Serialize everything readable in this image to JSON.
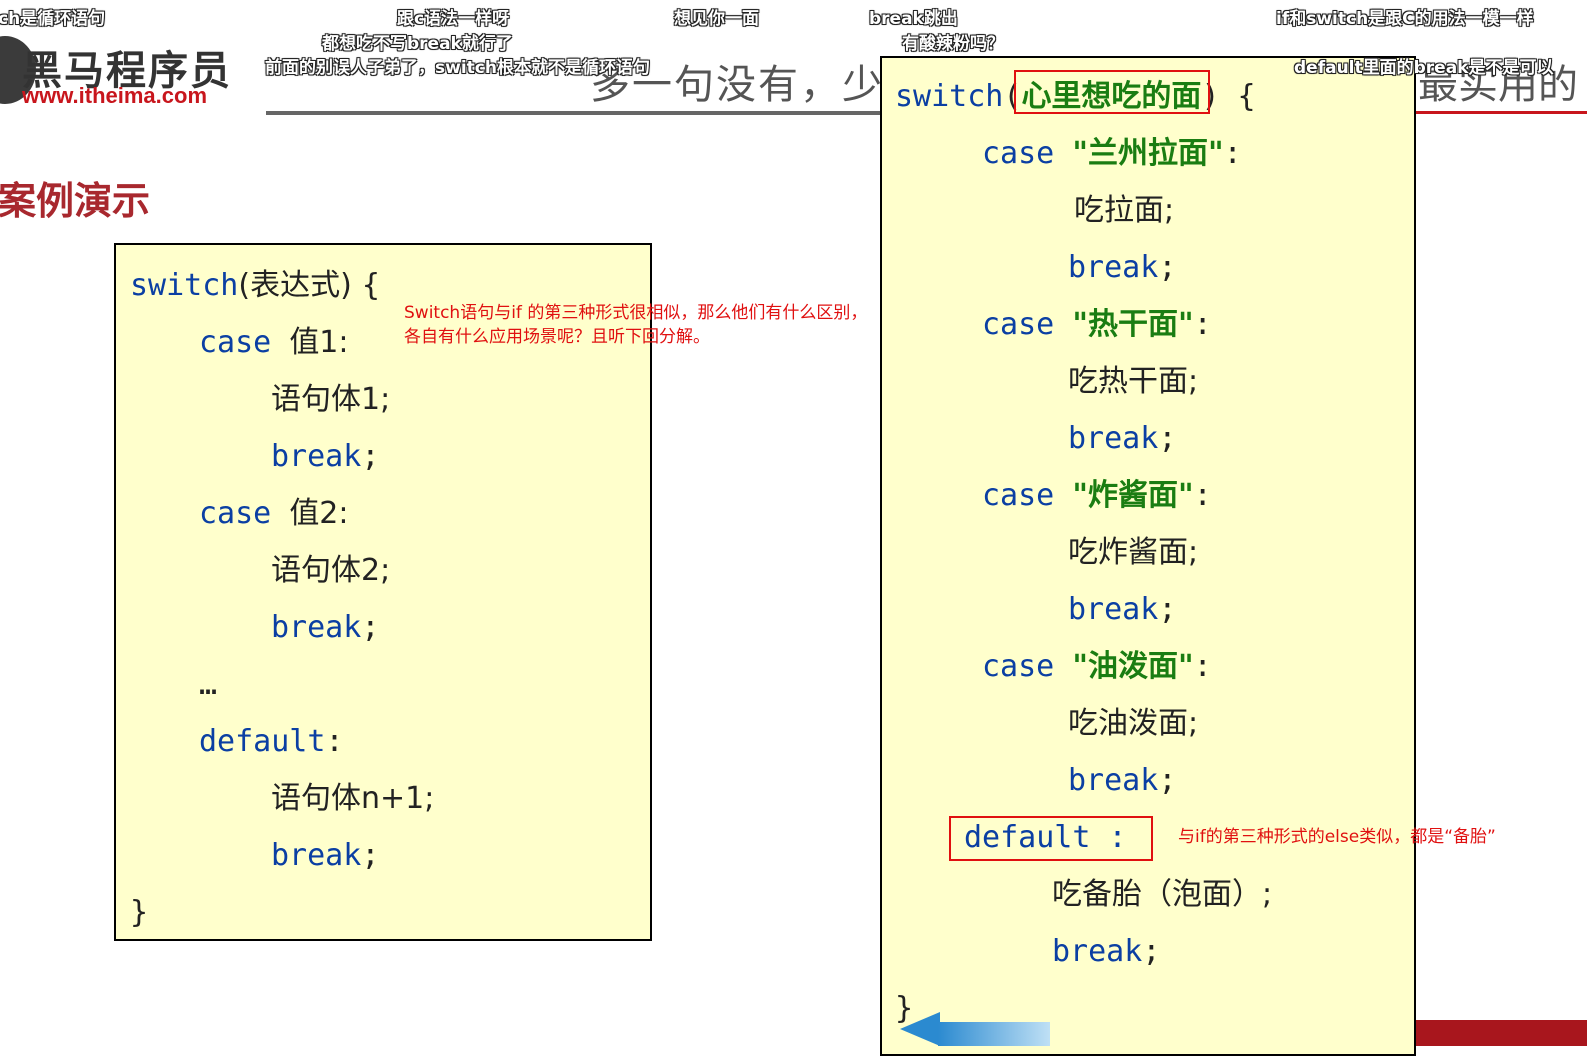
{
  "header": {
    "logo_name": "黑马程序员",
    "logo_url": "www.itheima.com",
    "subtitle_left": "多一句没有，少",
    "subtitle_right": "最实用的"
  },
  "section_title": "案例演示",
  "left_code": {
    "switch_kw": "switch",
    "switch_rest": "(表达式) {",
    "case1_kw": "case",
    "case1_val": "值1:",
    "stmt1": "语句体1;",
    "break1": "break",
    "semi": ";",
    "case2_kw": "case",
    "case2_val": "值2:",
    "stmt2": "语句体2;",
    "break2": "break",
    "ellipsis": "…",
    "default_kw": "default",
    "colon": ":",
    "stmtn": "语句体n+1;",
    "break3": "break",
    "close": "}"
  },
  "right_code": {
    "switch_kw": "switch",
    "paren_open": "(",
    "switch_expr": "心里想吃的面",
    "paren_close": ") {",
    "case_kw": "case",
    "break_kw": "break",
    "semi": ";",
    "colon": ":",
    "cases": [
      {
        "value": "\"兰州拉面\"",
        "stmt": "吃拉面;"
      },
      {
        "value": "\"热干面\"",
        "stmt": "吃热干面;"
      },
      {
        "value": "\"炸酱面\"",
        "stmt": "吃炸酱面;"
      },
      {
        "value": "\"油泼面\"",
        "stmt": "吃油泼面;"
      }
    ],
    "default_label": "default :",
    "default_stmt": "吃备胎（泡面）;",
    "close": "}"
  },
  "notes": {
    "switch_vs_if_line1": "Switch语句与if 的第三种形式很相似，那么他们有什么区别，",
    "switch_vs_if_line2": "各自有什么应用场景呢？且听下回分解。",
    "default_note": "与if的第三种形式的else类似，都是“备胎”"
  },
  "danmaku": [
    "ch是循环语句",
    "跟c语法一样呀",
    "想见你一面",
    "break跳出",
    "if和switch是跟C的用法一模一样",
    "都想吃不写break就行了",
    "有酸辣粉吗？",
    "前面的别误人子弟了，switch根本就不是循环语句",
    "default里面的break是不是可以"
  ],
  "colors": {
    "code_bg": "#ffffcc",
    "keyword": "#0b3fa3",
    "string": "#1a7d12",
    "annotation": "#e01010",
    "title": "#a8282e"
  }
}
